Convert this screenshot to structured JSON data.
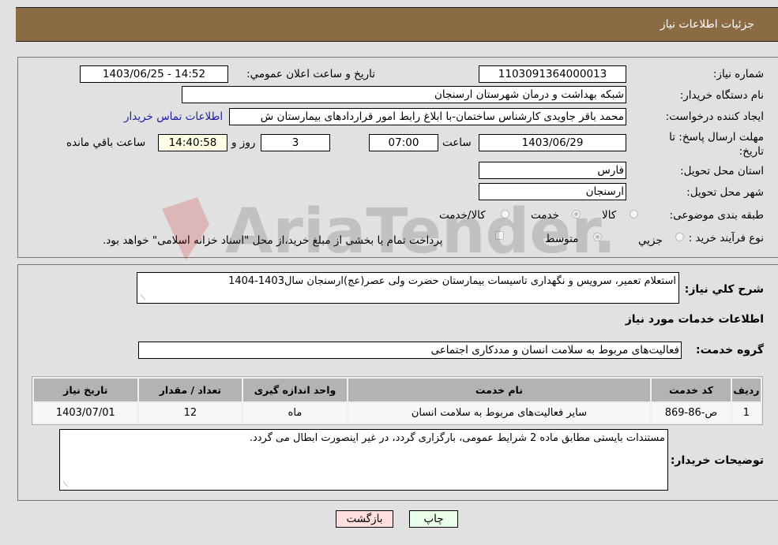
{
  "header": {
    "title": "جزئیات اطلاعات نیاز"
  },
  "fields": {
    "need_number_label": "شماره نیاز:",
    "need_number": "1103091364000013",
    "announce_label": "تاریخ و ساعت اعلان عمومي:",
    "announce_value": "1403/06/25 - 14:52",
    "buyer_org_label": "نام دستگاه خریدار:",
    "buyer_org": "شبکه بهداشت و درمان شهرستان ارسنجان",
    "creator_label": "ایجاد کننده درخواست:",
    "creator": "محمد باقر جاویدی کارشناس ساختمان-با ابلاغ رابط امور قراردادهای بیمارستان ش",
    "contact_link": "اطلاعات تماس خریدار",
    "deadline_label": "مهلت ارسال پاسخ: تا تاریخ:",
    "deadline_date": "1403/06/29",
    "time_label": "ساعت",
    "deadline_time": "07:00",
    "days_value": "3",
    "days_label": "روز و",
    "remaining_time": "14:40:58",
    "remaining_label": "ساعت باقي مانده",
    "province_label": "استان محل تحویل:",
    "province": "فارس",
    "city_label": "شهر محل تحویل:",
    "city": "ارسنجان",
    "category_label": "طبقه بندی موضوعی:",
    "category_options": [
      "کالا",
      "خدمت",
      "کالا/خدمت"
    ],
    "category_selected": "خدمت",
    "process_label": "نوع فرآیند خرید :",
    "process_options": [
      "جزيي",
      "متوسط"
    ],
    "process_selected": "متوسط",
    "treasury_note": "پرداخت تمام یا بخشی از مبلغ خرید،از محل \"اسناد خزانه اسلامی\" خواهد بود.",
    "treasury_checked": false
  },
  "description": {
    "label": "شرح كلي نياز:",
    "value": "استعلام تعمیر، سرویس و نگهداری تاسیسات بیمارستان حضرت ولی عصر(عج)ارسنجان سال1403-1404"
  },
  "services": {
    "section_title": "اطلاعات خدمات مورد نیاز",
    "group_label": "گروه خدمت:",
    "group_value": "فعالیت‌های مربوط به سلامت انسان و مددکاری اجتماعی",
    "columns": [
      "ردیف",
      "کد خدمت",
      "نام خدمت",
      "واحد اندازه گیری",
      "تعداد / مقدار",
      "تاریخ نیاز"
    ],
    "rows": [
      [
        "1",
        "ص-86-869",
        "سایر فعالیت‌های مربوط به سلامت انسان",
        "ماه",
        "12",
        "1403/07/01"
      ]
    ]
  },
  "buyer_notes": {
    "label": "توضیحات خریدار:",
    "value": "مستندات بایستی مطابق ماده 2 شرایط عمومی، بارگزاری گردد، در غیر اینصورت ابطال می گردد."
  },
  "buttons": {
    "print": "چاپ",
    "back": "بازگشت"
  },
  "watermark": "AriaTender.neT"
}
